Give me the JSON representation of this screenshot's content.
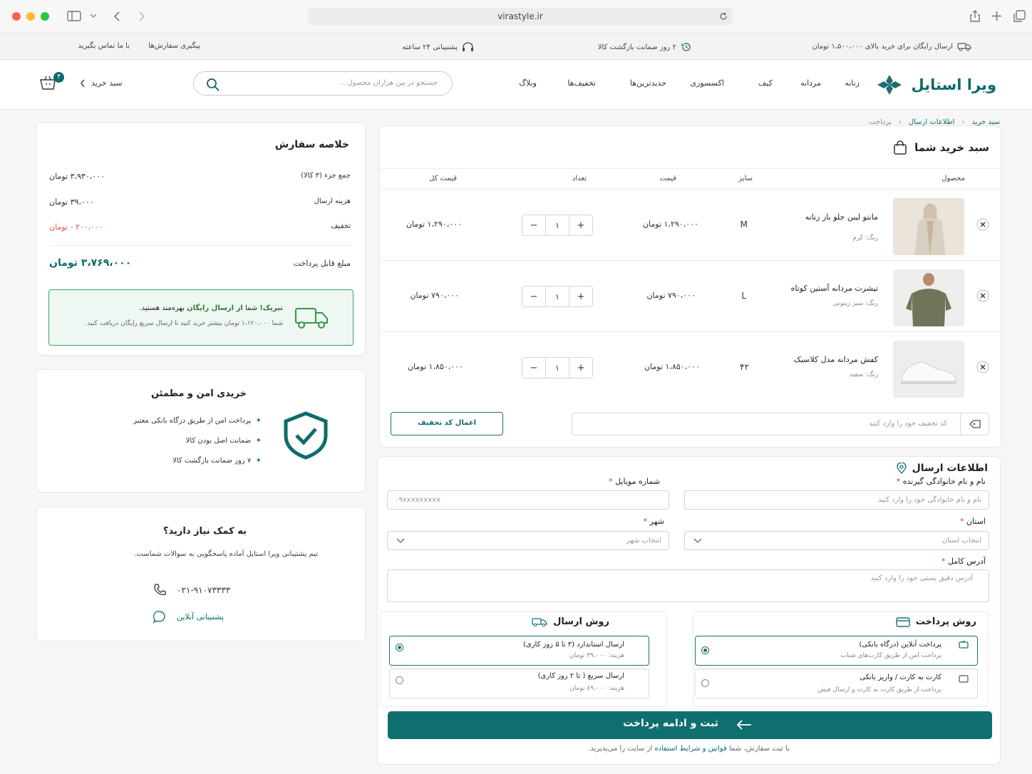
{
  "browser": {
    "url": "virastyle.ir"
  },
  "topbar": {
    "free_shipping": "ارسال رایگان برای خرید بالای ۱،۵۰۰،۰۰۰ تومان",
    "return_guarantee": "۲ روز ضمانت بازگشت کالا",
    "support_24": "پشتیبانی ۲۴ ساعته",
    "track_orders": "پیگیری سفارش‌ها",
    "contact_us": "با ما تماس بگیرید"
  },
  "header": {
    "brand": "ویرا استایل",
    "nav": [
      "زنانه",
      "مردانه",
      "کیف",
      "اکسسوری",
      "جدیدترین‌ها",
      "تخفیف‌ها",
      "وبلاگ"
    ],
    "search_placeholder": "جستجو در بین هزاران محصول...",
    "cart_label": "سبد خرید",
    "cart_count": "۳"
  },
  "breadcrumb": [
    "سبد خرید",
    "اطلاعات ارسال",
    "پرداخت"
  ],
  "cart": {
    "title": "سبد خرید شما",
    "columns": {
      "product": "محصول",
      "size": "سایز",
      "price": "قیمت",
      "qty": "تعداد",
      "total": "قیمت کل"
    },
    "items": [
      {
        "name": "مانتو لینن جلو باز زنانه",
        "color": "رنگ: کرم",
        "size": "M",
        "price": "۱،۲۹۰،۰۰۰ تومان",
        "qty": "۱",
        "total": "۱،۲۹۰،۰۰۰ تومان"
      },
      {
        "name": "تیشرت مردانه آستین کوتاه",
        "color": "رنگ: سبز زیتونی",
        "size": "L",
        "price": "۷۹۰،۰۰۰ تومان",
        "qty": "۱",
        "total": "۷۹۰،۰۰۰ تومان"
      },
      {
        "name": "کفش مردانه مدل کلاسیک",
        "color": "رنگ: سفید",
        "size": "۴۲",
        "price": "۱،۸۵۰،۰۰۰ تومان",
        "qty": "۱",
        "total": "۱،۸۵۰،۰۰۰ تومان"
      }
    ],
    "coupon_placeholder": "کد تخفیف خود را وارد کنید",
    "coupon_button": "اعمال کد تخفیف"
  },
  "shipping_form": {
    "title": "اطلاعات ارسال",
    "fullname_label": "نام و نام خانوادگی گیرنده",
    "fullname_placeholder": "نام و نام خانوادگی خود را وارد کنید",
    "mobile_label": "شماره موبایل",
    "mobile_placeholder": "۰۹xxxxxxxxx",
    "province_label": "استان",
    "province_placeholder": "انتخاب استان",
    "city_label": "شهر",
    "city_placeholder": "انتخاب شهر",
    "address_label": "آدرس کامل",
    "address_placeholder": "آدرس دقیق پستی خود را وارد کنید",
    "required_mark": "*"
  },
  "payment": {
    "title": "روش پرداخت",
    "options": [
      {
        "title": "پرداخت آنلاین (درگاه بانکی)",
        "desc": "پرداخت امن از طریق کارت‌های شتاب"
      },
      {
        "title": "کارت به کارت / واریز بانکی",
        "desc": "پرداخت از طریق کارت به کارت و ارسال فیش"
      }
    ]
  },
  "shipping_method": {
    "title": "روش ارسال",
    "options": [
      {
        "title": "ارسال استاندارد (۳ تا ۵ روز کاری)",
        "desc": "هزینه: ۳۹،۰۰۰ تومان"
      },
      {
        "title": "ارسال سریع ( تا ۲ روز کاری)",
        "desc": "هزینه: ۸۹،۰۰۰ تومان"
      }
    ]
  },
  "submit": {
    "label": "ثبت و ادامه پرداخت",
    "terms_prefix": "با ثبت سفارش، شما",
    "terms_link": "قوانین و شرایط استفاده",
    "terms_suffix": "از سایت را می‌پذیرید."
  },
  "summary": {
    "title": "خلاصه سفارش",
    "subtotal_label": "جمع جزء (۳ کالا)",
    "subtotal_value": "۳،۹۳۰،۰۰۰ تومان",
    "shipping_label": "هزینه ارسال",
    "shipping_value": "۳۹،۰۰۰ تومان",
    "discount_label": "تخفیف",
    "discount_value": "۲۰۰،۰۰۰ - تومان",
    "payable_label": "مبلغ قابل پرداخت",
    "payable_value": "۳،۷۶۹،۰۰۰ تومان",
    "promo_prefix": "تبریک!",
    "promo_mid": "شما",
    "promo_bold": "از ارسال رایگان",
    "promo_suffix": "بهره‌مند هستید.",
    "promo_sub": "شما ۱،۱۲۰،۰۰۰ تومان بیشتر خرید کنید تا ارسال سریع رایگان دریافت کنید."
  },
  "secure": {
    "title": "خریدی امن و مطمئن",
    "items": [
      "پرداخت امن از طریق درگاه بانکی معتبر",
      "ضمانت اصل بودن کالا",
      "۷ روز ضمانت بازگشت کالا"
    ]
  },
  "help": {
    "title": "به کمک نیاز دارید؟",
    "desc": "تیم پشتیبانی ویرا استایل آماده پاسخگویی به سوالات شماست.",
    "phone": "۰۲۱-۹۱۰۷۳۳۳۳",
    "online": "پشتیبانی آنلاین"
  },
  "colors": {
    "brand": "#0f6b6b",
    "discount": "#d9534f",
    "accent_green": "#2e9a4a"
  }
}
